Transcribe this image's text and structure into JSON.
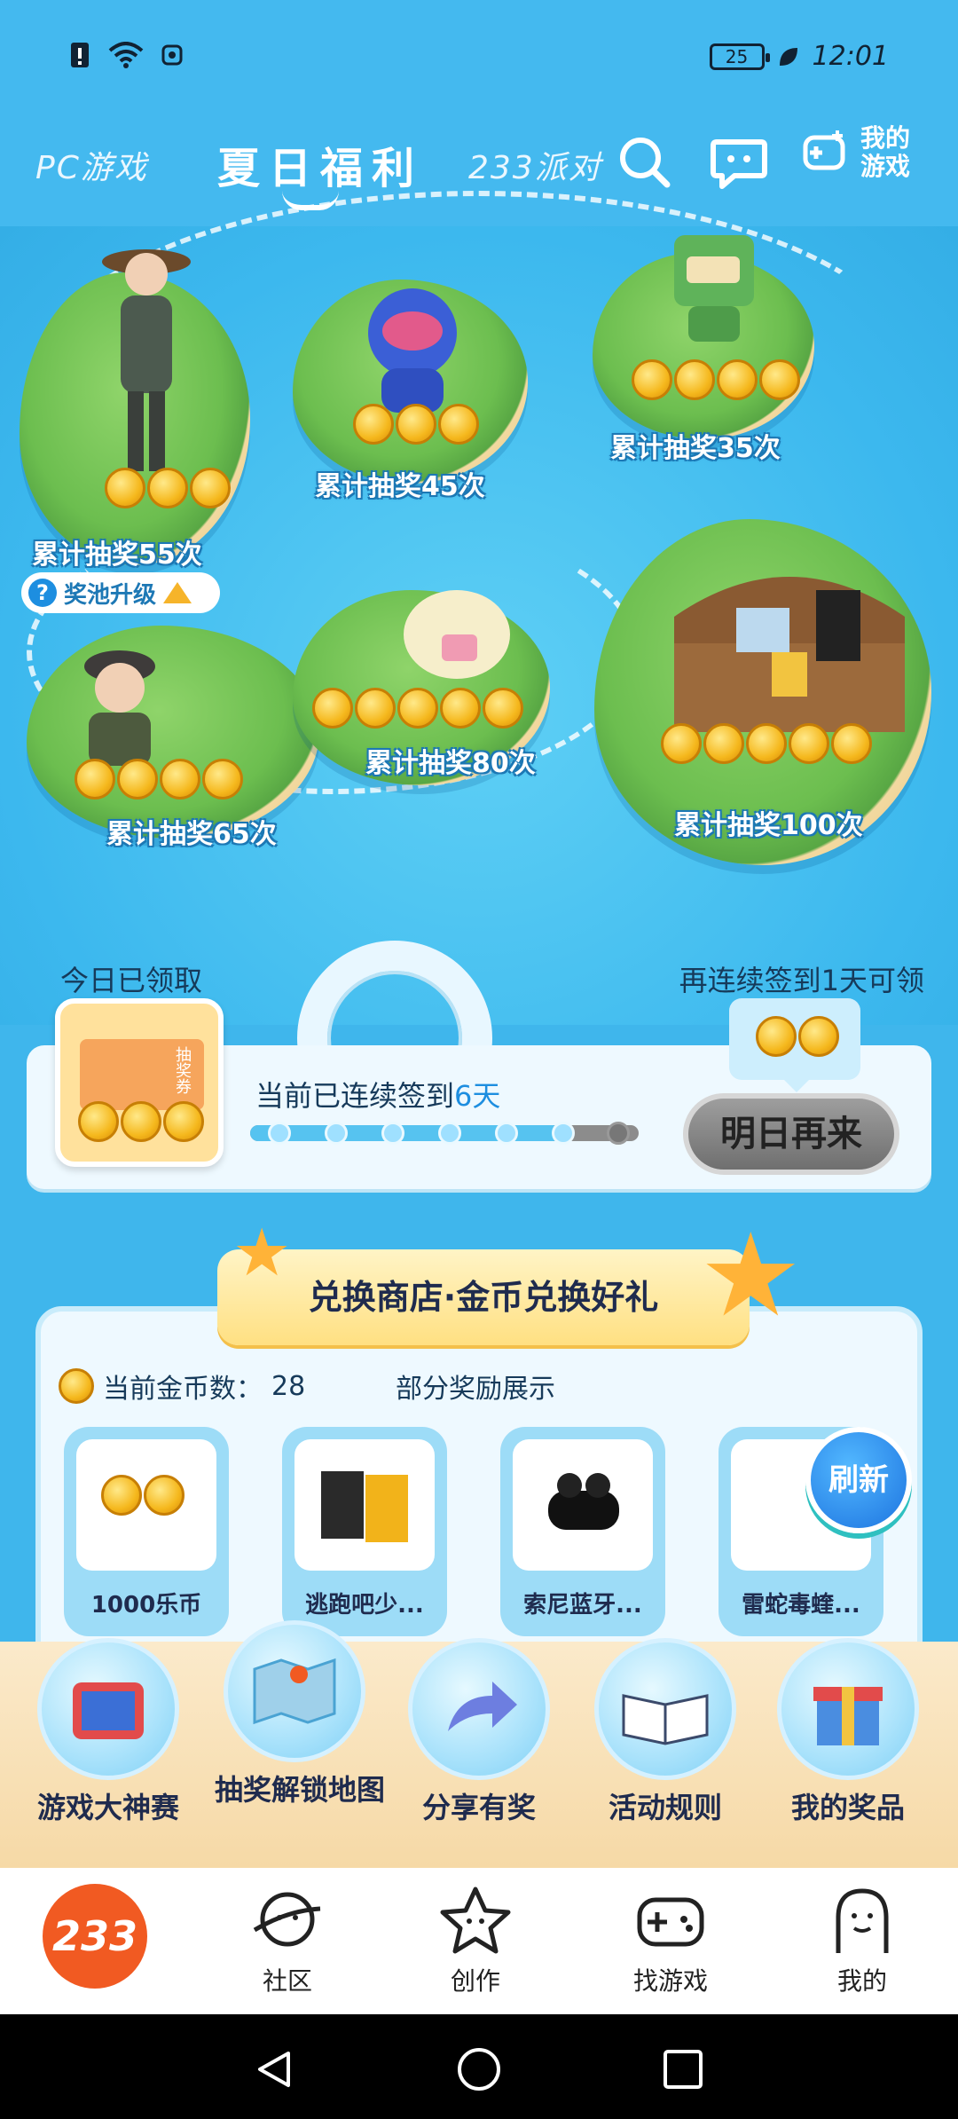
{
  "status_bar": {
    "time": "12:01",
    "battery": "25"
  },
  "top_nav": {
    "tabs": [
      {
        "label": "PC游戏"
      },
      {
        "label": "夏日福利"
      },
      {
        "label": "233派对"
      }
    ],
    "my_games_label": "我的游戏"
  },
  "map": {
    "milestones": [
      {
        "label": "累计抽奖55次"
      },
      {
        "label": "累计抽奖45次"
      },
      {
        "label": "累计抽奖35次"
      },
      {
        "label": "累计抽奖65次"
      },
      {
        "label": "累计抽奖80次"
      },
      {
        "label": "累计抽奖100次"
      }
    ],
    "pool_upgrade": "奖池升级"
  },
  "signin": {
    "today_label": "今日已领取",
    "again_label": "再连续签到1天可领",
    "ticket_text": "抽奖券",
    "streak_prefix": "当前已连续签到",
    "streak_days": "6天",
    "progress": 0.8,
    "button": "明日再来"
  },
  "shop": {
    "title": "兑换商店·金币兑换好礼",
    "coin_label": "当前金币数：",
    "coin_count": "28",
    "reward_display": "部分奖励展示",
    "items": [
      {
        "name": "1000乐币"
      },
      {
        "name": "逃跑吧少..."
      },
      {
        "name": "索尼蓝牙..."
      },
      {
        "name": "雷蛇毒蝰..."
      }
    ],
    "refresh": "刷新"
  },
  "functions": [
    {
      "label": "游戏大神赛"
    },
    {
      "label": "抽奖解锁地图"
    },
    {
      "label": "分享有奖"
    },
    {
      "label": "活动规则"
    },
    {
      "label": "我的奖品"
    }
  ],
  "bottom_nav": {
    "logo": "233",
    "items": [
      {
        "label": "社区"
      },
      {
        "label": "创作"
      },
      {
        "label": "找游戏"
      },
      {
        "label": "我的"
      }
    ]
  },
  "colors": {
    "sky": "#44b9ef",
    "sea": "#3cb8ee",
    "accent_blue": "#1d8ee0",
    "coin": "#f5b81d",
    "logo_orange": "#f15a22"
  }
}
